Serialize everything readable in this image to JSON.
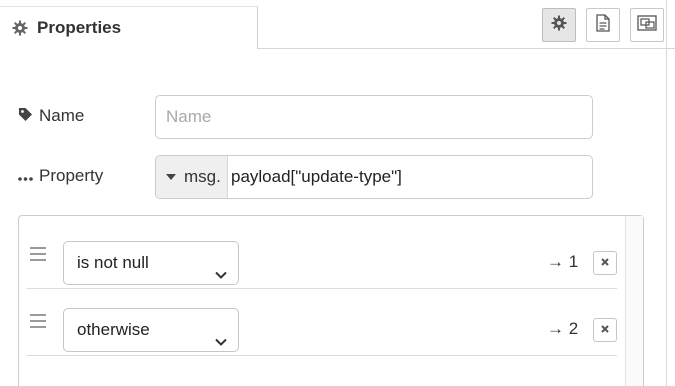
{
  "tab": {
    "title": "Properties",
    "icon": "gear-icon",
    "buttons": [
      {
        "name": "settings",
        "icon": "gear-icon",
        "active": true
      },
      {
        "name": "description",
        "icon": "document-icon",
        "active": false
      },
      {
        "name": "appearance",
        "icon": "frame-icon",
        "active": false
      }
    ]
  },
  "form": {
    "name": {
      "label": "Name",
      "icon": "tag-icon",
      "value": "",
      "placeholder": "Name"
    },
    "property": {
      "label": "Property",
      "icon": "ellipsis-icon",
      "type": "msg.",
      "value": "payload[\"update-type\"]"
    }
  },
  "rules": [
    {
      "operator": "is not null",
      "output": "→ 1"
    },
    {
      "operator": "otherwise",
      "output": "→ 2"
    }
  ],
  "colors": {
    "border": "#cccccc",
    "text": "#333333",
    "active_tab_button": "#e6e6e6"
  }
}
